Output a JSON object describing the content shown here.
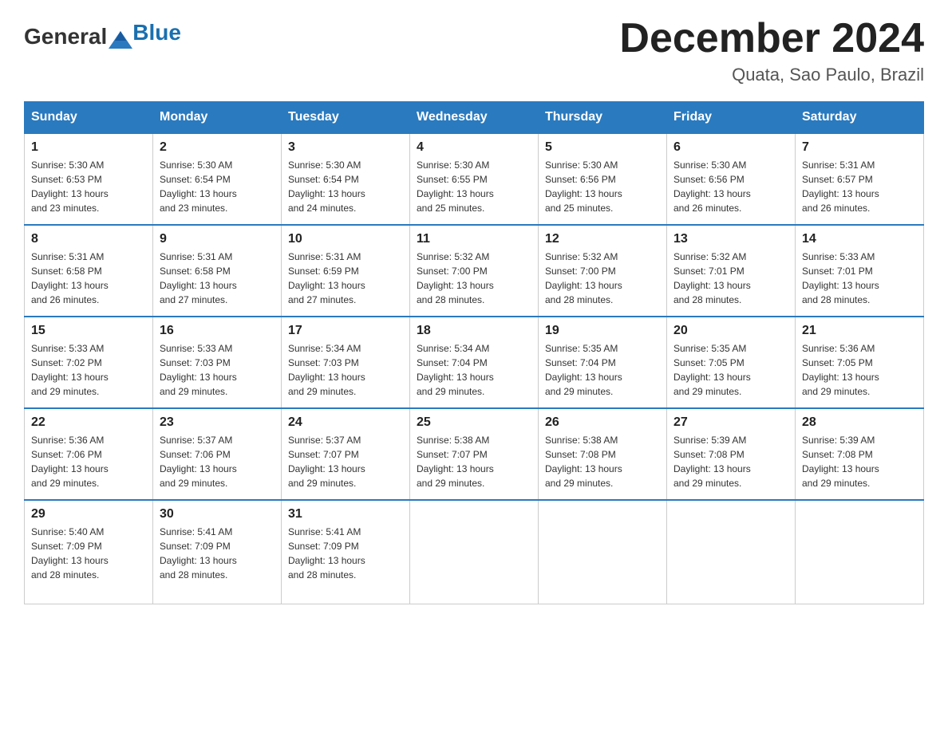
{
  "header": {
    "logo_general": "General",
    "logo_blue": "Blue",
    "month_title": "December 2024",
    "location": "Quata, Sao Paulo, Brazil"
  },
  "days_of_week": [
    "Sunday",
    "Monday",
    "Tuesday",
    "Wednesday",
    "Thursday",
    "Friday",
    "Saturday"
  ],
  "weeks": [
    [
      {
        "day": "1",
        "sunrise": "5:30 AM",
        "sunset": "6:53 PM",
        "daylight": "13 hours and 23 minutes."
      },
      {
        "day": "2",
        "sunrise": "5:30 AM",
        "sunset": "6:54 PM",
        "daylight": "13 hours and 23 minutes."
      },
      {
        "day": "3",
        "sunrise": "5:30 AM",
        "sunset": "6:54 PM",
        "daylight": "13 hours and 24 minutes."
      },
      {
        "day": "4",
        "sunrise": "5:30 AM",
        "sunset": "6:55 PM",
        "daylight": "13 hours and 25 minutes."
      },
      {
        "day": "5",
        "sunrise": "5:30 AM",
        "sunset": "6:56 PM",
        "daylight": "13 hours and 25 minutes."
      },
      {
        "day": "6",
        "sunrise": "5:30 AM",
        "sunset": "6:56 PM",
        "daylight": "13 hours and 26 minutes."
      },
      {
        "day": "7",
        "sunrise": "5:31 AM",
        "sunset": "6:57 PM",
        "daylight": "13 hours and 26 minutes."
      }
    ],
    [
      {
        "day": "8",
        "sunrise": "5:31 AM",
        "sunset": "6:58 PM",
        "daylight": "13 hours and 26 minutes."
      },
      {
        "day": "9",
        "sunrise": "5:31 AM",
        "sunset": "6:58 PM",
        "daylight": "13 hours and 27 minutes."
      },
      {
        "day": "10",
        "sunrise": "5:31 AM",
        "sunset": "6:59 PM",
        "daylight": "13 hours and 27 minutes."
      },
      {
        "day": "11",
        "sunrise": "5:32 AM",
        "sunset": "7:00 PM",
        "daylight": "13 hours and 28 minutes."
      },
      {
        "day": "12",
        "sunrise": "5:32 AM",
        "sunset": "7:00 PM",
        "daylight": "13 hours and 28 minutes."
      },
      {
        "day": "13",
        "sunrise": "5:32 AM",
        "sunset": "7:01 PM",
        "daylight": "13 hours and 28 minutes."
      },
      {
        "day": "14",
        "sunrise": "5:33 AM",
        "sunset": "7:01 PM",
        "daylight": "13 hours and 28 minutes."
      }
    ],
    [
      {
        "day": "15",
        "sunrise": "5:33 AM",
        "sunset": "7:02 PM",
        "daylight": "13 hours and 29 minutes."
      },
      {
        "day": "16",
        "sunrise": "5:33 AM",
        "sunset": "7:03 PM",
        "daylight": "13 hours and 29 minutes."
      },
      {
        "day": "17",
        "sunrise": "5:34 AM",
        "sunset": "7:03 PM",
        "daylight": "13 hours and 29 minutes."
      },
      {
        "day": "18",
        "sunrise": "5:34 AM",
        "sunset": "7:04 PM",
        "daylight": "13 hours and 29 minutes."
      },
      {
        "day": "19",
        "sunrise": "5:35 AM",
        "sunset": "7:04 PM",
        "daylight": "13 hours and 29 minutes."
      },
      {
        "day": "20",
        "sunrise": "5:35 AM",
        "sunset": "7:05 PM",
        "daylight": "13 hours and 29 minutes."
      },
      {
        "day": "21",
        "sunrise": "5:36 AM",
        "sunset": "7:05 PM",
        "daylight": "13 hours and 29 minutes."
      }
    ],
    [
      {
        "day": "22",
        "sunrise": "5:36 AM",
        "sunset": "7:06 PM",
        "daylight": "13 hours and 29 minutes."
      },
      {
        "day": "23",
        "sunrise": "5:37 AM",
        "sunset": "7:06 PM",
        "daylight": "13 hours and 29 minutes."
      },
      {
        "day": "24",
        "sunrise": "5:37 AM",
        "sunset": "7:07 PM",
        "daylight": "13 hours and 29 minutes."
      },
      {
        "day": "25",
        "sunrise": "5:38 AM",
        "sunset": "7:07 PM",
        "daylight": "13 hours and 29 minutes."
      },
      {
        "day": "26",
        "sunrise": "5:38 AM",
        "sunset": "7:08 PM",
        "daylight": "13 hours and 29 minutes."
      },
      {
        "day": "27",
        "sunrise": "5:39 AM",
        "sunset": "7:08 PM",
        "daylight": "13 hours and 29 minutes."
      },
      {
        "day": "28",
        "sunrise": "5:39 AM",
        "sunset": "7:08 PM",
        "daylight": "13 hours and 29 minutes."
      }
    ],
    [
      {
        "day": "29",
        "sunrise": "5:40 AM",
        "sunset": "7:09 PM",
        "daylight": "13 hours and 28 minutes."
      },
      {
        "day": "30",
        "sunrise": "5:41 AM",
        "sunset": "7:09 PM",
        "daylight": "13 hours and 28 minutes."
      },
      {
        "day": "31",
        "sunrise": "5:41 AM",
        "sunset": "7:09 PM",
        "daylight": "13 hours and 28 minutes."
      },
      null,
      null,
      null,
      null
    ]
  ],
  "labels": {
    "sunrise": "Sunrise:",
    "sunset": "Sunset:",
    "daylight": "Daylight:"
  }
}
